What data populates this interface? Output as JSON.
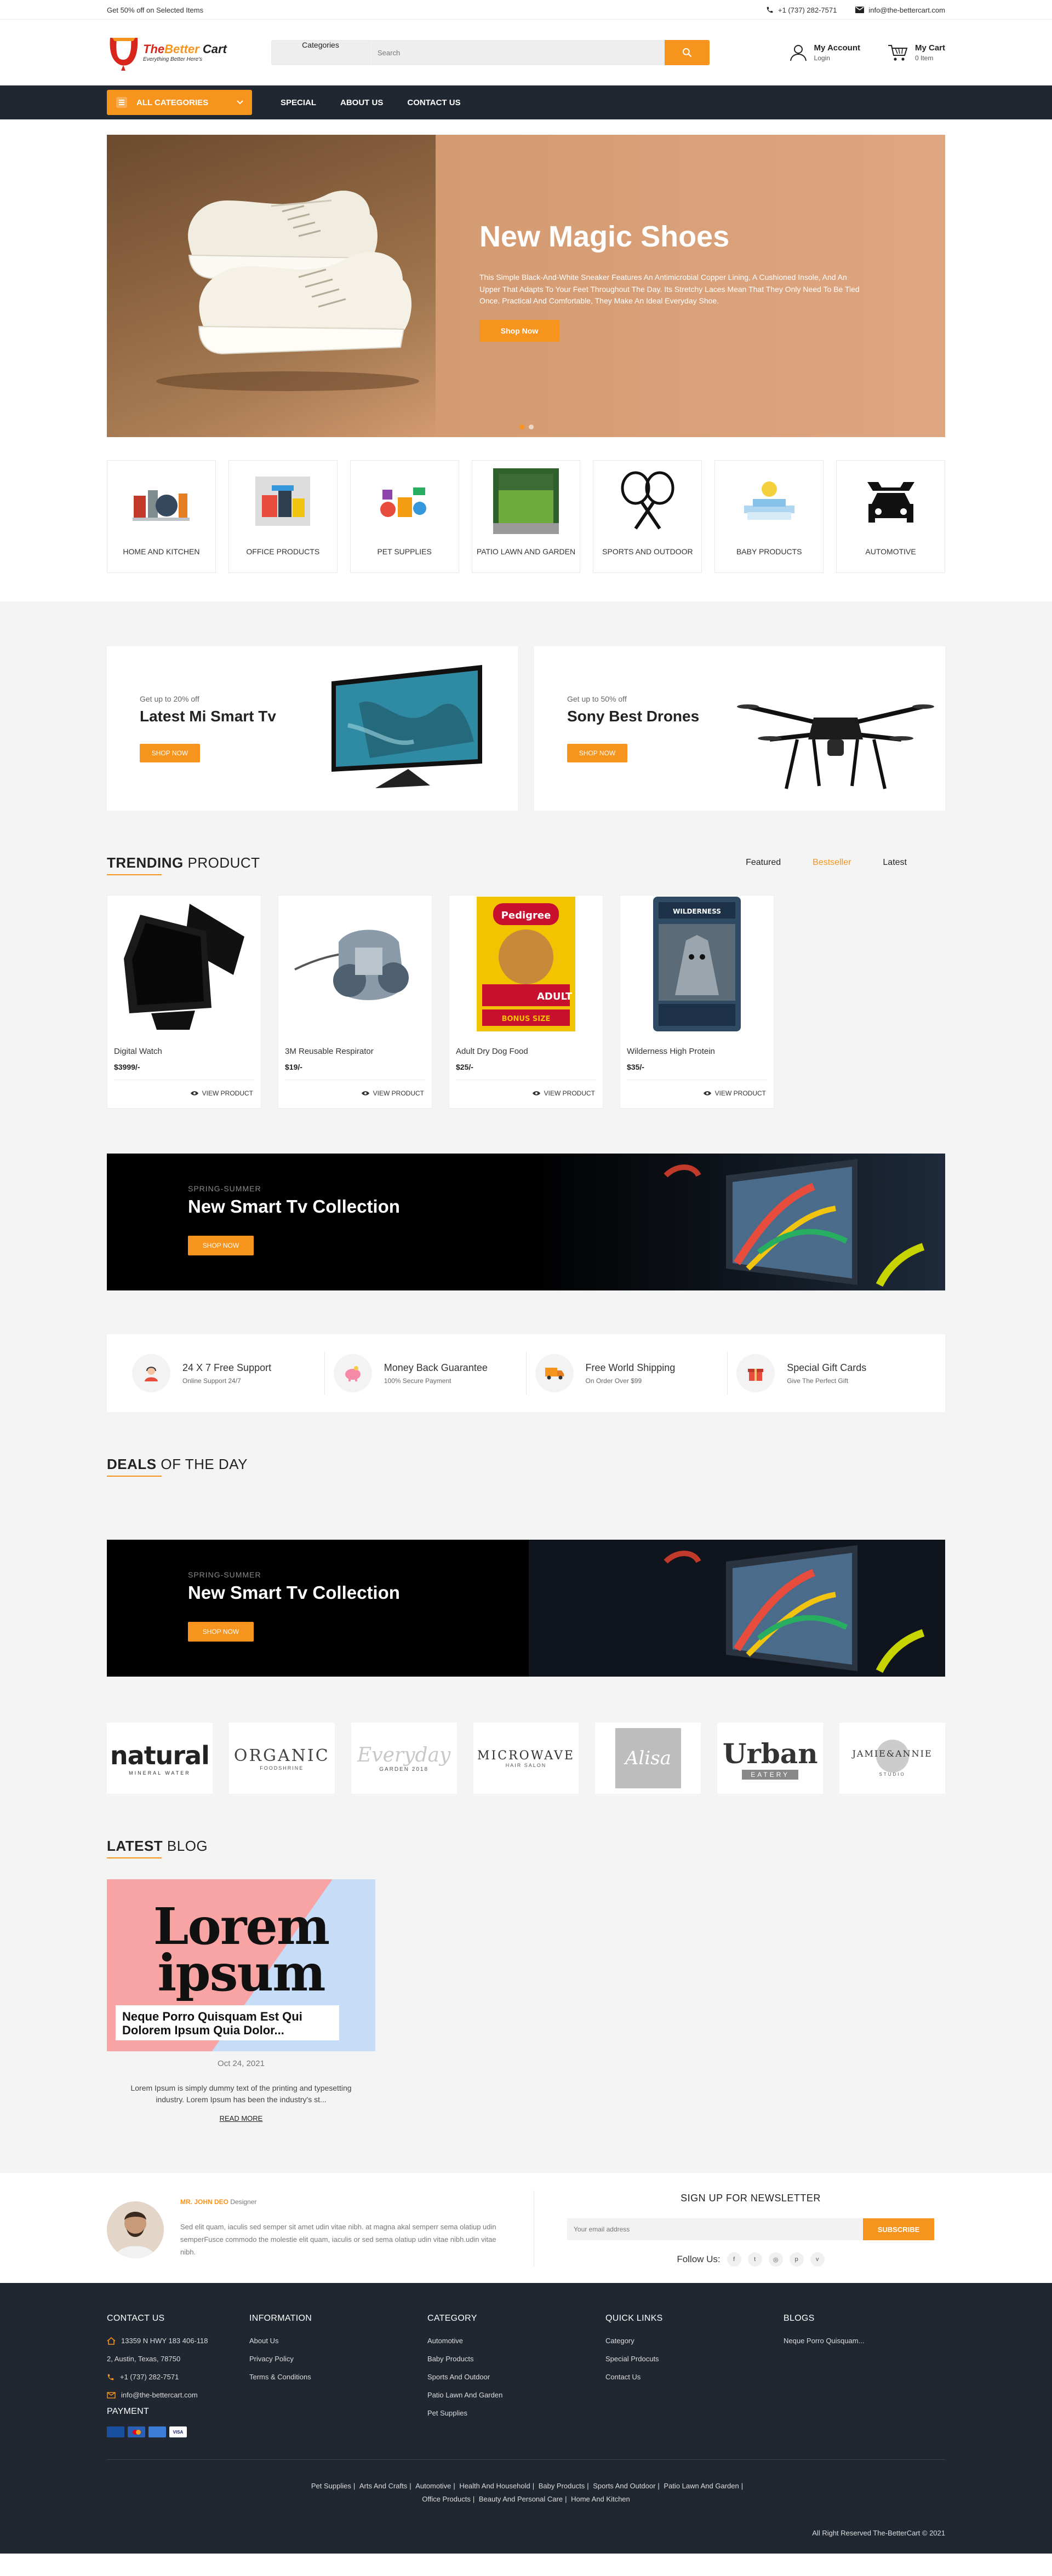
{
  "topbar": {
    "promo": "Get 50% off on Selected Items",
    "phone": "+1 (737) 282-7571",
    "email": "info@the-bettercart.com"
  },
  "header": {
    "logo_name_a": "The",
    "logo_name_b": "Better",
    "logo_name_c": " Cart",
    "logo_tagline": "Everything Better Here's",
    "search_category": "Categories",
    "search_placeholder": "Search",
    "account_title": "My Account",
    "account_sub": "Login",
    "cart_title": "My Cart",
    "cart_sub": "0 Item"
  },
  "nav": {
    "all_categories": "ALL CATEGORIES",
    "links": [
      "SPECIAL",
      "ABOUT US",
      "CONTACT US"
    ]
  },
  "hero": {
    "title": "New Magic Shoes",
    "text": "This Simple Black-And-White Sneaker Features An Antimicrobial Copper Lining, A Cushioned Insole, And An Upper That Adapts To Your Feet Throughout The Day. Its Stretchy Laces Mean That They Only Need To Be Tied Once. Practical And Comfortable, They Make An Ideal Everyday Shoe.",
    "button": "Shop Now"
  },
  "categories": [
    "HOME AND KITCHEN",
    "OFFICE PRODUCTS",
    "PET SUPPLIES",
    "PATIO LAWN AND GARDEN",
    "SPORTS AND OUTDOOR",
    "BABY PRODUCTS",
    "AUTOMOTIVE"
  ],
  "promos": [
    {
      "small": "Get up to 20% off",
      "title": "Latest Mi Smart Tv",
      "button": "SHOP NOW"
    },
    {
      "small": "Get up to 50% off",
      "title": "Sony Best Drones",
      "button": "SHOP NOW"
    }
  ],
  "trending": {
    "title_bold": "TRENDING",
    "title_rest": " PRODUCT",
    "tabs": [
      "Featured",
      "Bestseller",
      "Latest"
    ],
    "active_tab": "Bestseller",
    "view_label": "VIEW PRODUCT",
    "products": [
      {
        "name": "Digital Watch",
        "price": "$3999/-"
      },
      {
        "name": "3M Reusable Respirator",
        "price": "$19/-"
      },
      {
        "name": "Adult Dry Dog Food",
        "price": "$25/-"
      },
      {
        "name": "Wilderness High Protein",
        "price": "$35/-"
      }
    ],
    "dogfood_brand": "Pedigree",
    "dogfood_label": "ADULT",
    "dogfood_bonus": "BONUS SIZE",
    "wolf_brand": "WILDERNESS"
  },
  "tv_banner": {
    "small": "SPRING-SUMMER",
    "title": "New Smart Tv Collection",
    "button": "SHOP NOW"
  },
  "services": [
    {
      "title": "24 X 7 Free Support",
      "sub": "Online Support 24/7"
    },
    {
      "title": "Money Back Guarantee",
      "sub": "100% Secure Payment"
    },
    {
      "title": "Free World Shipping",
      "sub": "On Order Over $99"
    },
    {
      "title": "Special Gift Cards",
      "sub": "Give The Perfect Gift"
    }
  ],
  "deals": {
    "title_bold": "DEALS",
    "title_rest": " OF THE DAY"
  },
  "brands": [
    {
      "name": "natural",
      "sub": "MINERAL WATER"
    },
    {
      "name": "ORGANIC",
      "sub": "FOODSHRINE"
    },
    {
      "name": "Everyday",
      "sub": "GARDEN 2018"
    },
    {
      "name": "MICROWAVE",
      "sub": "HAIR SALON"
    },
    {
      "name": "Alisa",
      "sub": ""
    },
    {
      "name": "Urban",
      "sub": "EATERY"
    },
    {
      "name": "JAMIE&ANNIE",
      "sub": "STUDIO"
    }
  ],
  "blog": {
    "title_bold": "LATEST",
    "title_rest": " BLOG",
    "image_text": "Lorem ipsum",
    "caption": "Neque Porro Quisquam Est Qui Dolorem Ipsum Quia Dolor...",
    "date": "Oct 24, 2021",
    "excerpt": "Lorem Ipsum is simply dummy text of the printing and typesetting industry. Lorem Ipsum has been the industry's st...",
    "read_more": "READ MORE"
  },
  "testimonial": {
    "name": "MR. JOHN DEO",
    "role": " Designer",
    "quote": "Sed elit quam, iaculis sed semper sit amet udin vitae nibh. at magna akal semperr sema olatiup udin semperFusce commodo the molestie elit quam, iaculis or sed sema olatiup udin vitae nibh.udin vitae nibh."
  },
  "newsletter": {
    "title": "SIGN UP FOR NEWSLETTER",
    "placeholder": "Your email address",
    "button": "SUBSCRIBE",
    "follow": "Follow Us:"
  },
  "footer": {
    "contact": {
      "title": "CONTACT US",
      "address1": "13359 N HWY 183 406-118",
      "address2": "2, Austin, Texas, 78750",
      "phone": "+1 (737) 282-7571",
      "email": "info@the-bettercart.com"
    },
    "payment_title": "PAYMENT",
    "columns": [
      {
        "title": "INFORMATION",
        "links": [
          "About Us",
          "Privacy Policy",
          "Terms & Conditions"
        ]
      },
      {
        "title": "CATEGORY",
        "links": [
          "Automotive",
          "Baby Products",
          "Sports And Outdoor",
          "Patio Lawn And Garden",
          "Pet Supplies"
        ]
      },
      {
        "title": "QUICK LINKS",
        "links": [
          "Category",
          "Special Prdocuts",
          "Contact Us"
        ]
      },
      {
        "title": "BLOGS",
        "links": [
          "Neque Porro Quisquam..."
        ]
      }
    ],
    "bottom_links": [
      "Pet Supplies",
      "Arts And Crafts",
      "Automotive",
      "Health And Household",
      "Baby Products",
      "Sports And Outdoor",
      "Patio Lawn And Garden",
      "Office Products",
      "Beauty And Personal Care",
      "Home And Kitchen"
    ],
    "copyright": "All Right Reserved The-BetterCart © 2021"
  },
  "colors": {
    "accent": "#f7941d",
    "dark": "#212730",
    "grey_bg": "#f4f4f4"
  }
}
